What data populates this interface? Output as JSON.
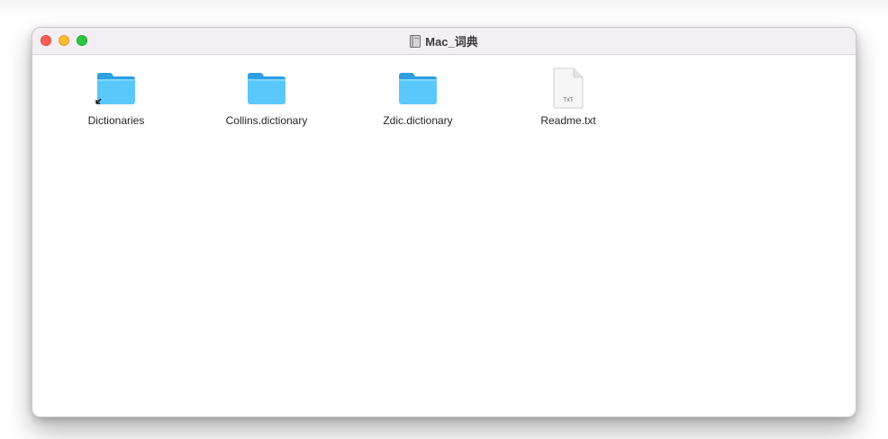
{
  "window": {
    "title": "Mac_词典"
  },
  "files": [
    {
      "name": "Dictionaries",
      "icon": "folder-alias-icon"
    },
    {
      "name": "Collins.dictionary",
      "icon": "folder-icon"
    },
    {
      "name": "Zdic.dictionary",
      "icon": "folder-icon"
    },
    {
      "name": "Readme.txt",
      "icon": "text-file-icon",
      "badge": "TXT"
    }
  ],
  "colors": {
    "folder_front": "#5ac8fa",
    "folder_back": "#2e9fe0",
    "close": "#fe5f57",
    "minimize": "#febc2e",
    "zoom": "#28c840"
  }
}
